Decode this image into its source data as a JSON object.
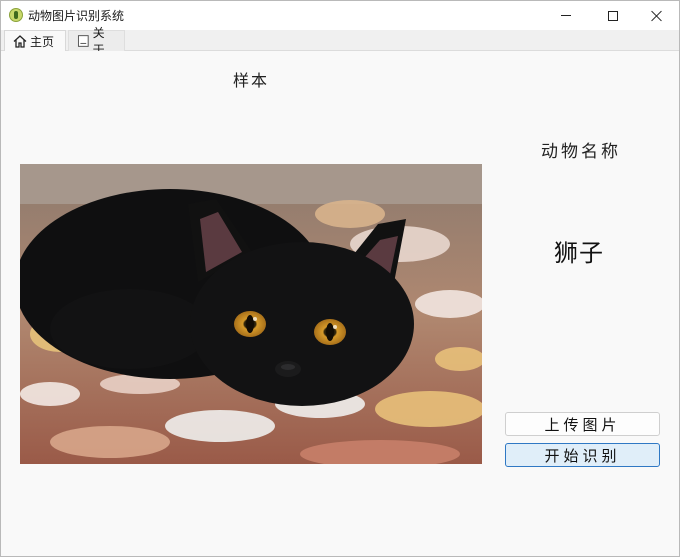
{
  "window": {
    "title": "动物图片识别系统",
    "icon": "app-leaf-icon"
  },
  "tabs": [
    {
      "label": "主页",
      "icon": "home-icon",
      "active": true
    },
    {
      "label": "关于",
      "icon": "document-icon",
      "active": false
    }
  ],
  "main": {
    "sample_label": "样本",
    "image": {
      "subject": "black cat lying on a patterned blanket"
    },
    "result_title": "动物名称",
    "result_value": "狮子",
    "upload_button": "上传图片",
    "start_button": "开始识别"
  },
  "colors": {
    "accent_border": "#2f78c4",
    "accent_fill": "#e0eef9"
  }
}
